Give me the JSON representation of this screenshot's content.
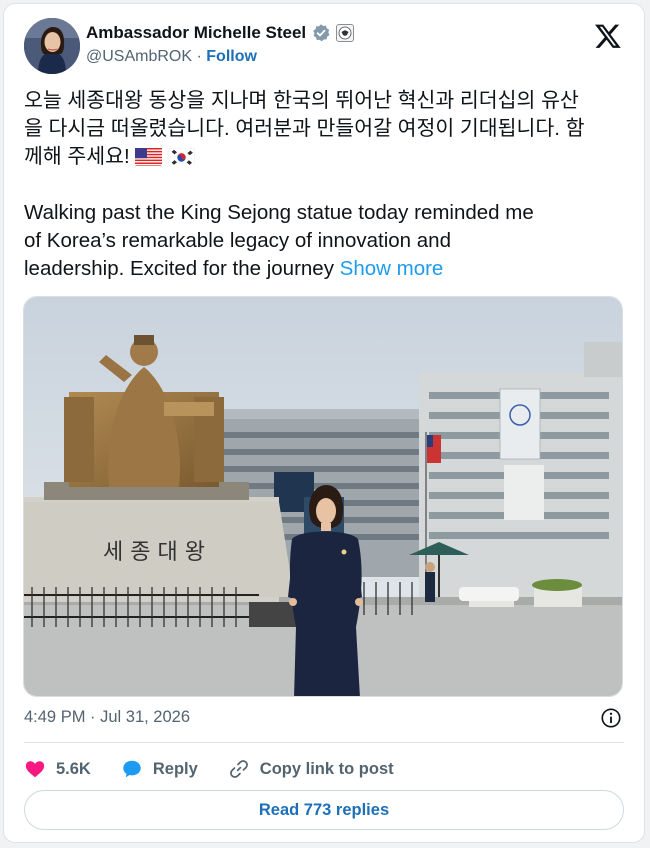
{
  "author": {
    "name": "Ambassador Michelle Steel",
    "handle": "@USAmbROK",
    "separator": "·",
    "follow_label": "Follow"
  },
  "icons": {
    "verified": "verified-badge-icon",
    "affiliate": "us-embassy-seal-icon",
    "platform": "x-logo-icon",
    "info": "info-icon",
    "like": "heart-icon",
    "reply": "reply-bubble-icon",
    "copy": "link-icon"
  },
  "post": {
    "korean_line1": "오늘 세종대왕 동상을 지나며 한국의 뛰어난 혁신과 리더십의 유산",
    "korean_line2": "을 다시금 떠올렸습니다. 여러분과 만들어갈 여정이 기대됩니다. 함",
    "korean_line3": "께해 주세요!",
    "flags": [
      "us-flag",
      "south-korea-flag"
    ],
    "english_line1": "Walking past the King Sejong statue today reminded me",
    "english_line2": "of Korea’s remarkable legacy of innovation and",
    "english_line3": "leadership. Excited for the journey",
    "show_more": "Show more",
    "photo_statue_text": "세 종 대 왕",
    "timestamp": "4:49 PM · Jul 31, 2026"
  },
  "actions": {
    "likes": "5.6K",
    "reply_label": "Reply",
    "copy_label": "Copy link to post",
    "read_replies": "Read 773 replies"
  },
  "colors": {
    "link": "#1d9bf0",
    "heart": "#f91880",
    "reply": "#1d9bf0",
    "follow": "#1d70b8",
    "muted": "#536471"
  }
}
